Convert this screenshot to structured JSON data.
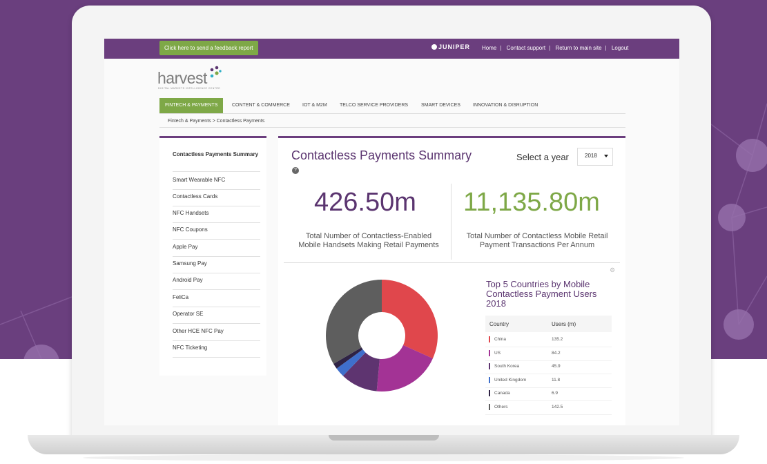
{
  "topbar": {
    "feedback_label": "Click here to send a feedback report",
    "brand": "JUNIPER",
    "links": [
      "Home",
      "Contact support",
      "Return to main site",
      "Logout"
    ]
  },
  "logo": {
    "name": "harvest",
    "tagline": "DIGITAL MARKETS INTELLIGENCE CENTRE"
  },
  "main_nav": [
    {
      "label": "FINTECH & PAYMENTS",
      "active": true
    },
    {
      "label": "CONTENT & COMMERCE",
      "active": false
    },
    {
      "label": "IOT & M2M",
      "active": false
    },
    {
      "label": "TELCO SERVICE PROVIDERS",
      "active": false
    },
    {
      "label": "SMART DEVICES",
      "active": false
    },
    {
      "label": "INNOVATION & DISRUPTION",
      "active": false
    }
  ],
  "breadcrumb": "Fintech & Payments > Contactless Payments",
  "sidebar": {
    "items": [
      "Contactless Payments Summary",
      "Smart Wearable NFC",
      "Contactless Cards",
      "NFC Handsets",
      "NFC Coupons",
      "Apple Pay",
      "Samsung Pay",
      "Android Pay",
      "FeliCa",
      "Operator SE",
      "Other HCE NFC Pay",
      "NFC Ticketing"
    ]
  },
  "summary": {
    "title": "Contactless Payments Summary",
    "help": "?",
    "year_label": "Select a year",
    "year_value": "2018",
    "stat1": {
      "value": "426.50m",
      "label_line1": "Total Number of Contactless-Enabled",
      "label_line2": "Mobile Handsets Making Retail Payments",
      "color": "#5b3570"
    },
    "stat2": {
      "value": "11,135.80m",
      "label_line1": "Total Number of Contactless Mobile Retail",
      "label_line2": "Payment Transactions Per Annum",
      "color": "#7ea847"
    }
  },
  "chart_data": {
    "type": "pie",
    "title": "Top 5 Countries by Mobile Contactless Payment Users 2018",
    "columns": [
      "Country",
      "Users (m)"
    ],
    "categories": [
      "China",
      "US",
      "South Korea",
      "United Kingdom",
      "Canada",
      "Others"
    ],
    "values": [
      135.2,
      84.2,
      45.9,
      11.8,
      6.9,
      142.5
    ],
    "colors": [
      "#e0474c",
      "#a33395",
      "#5e3470",
      "#3f6fcb",
      "#2f2345",
      "#5e5e5e"
    ]
  }
}
